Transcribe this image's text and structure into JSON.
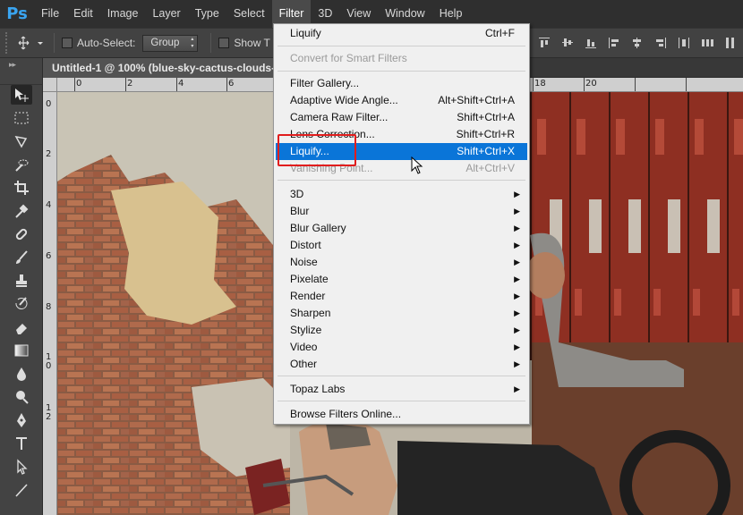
{
  "app": {
    "logo": "Ps"
  },
  "menubar": {
    "items": [
      "File",
      "Edit",
      "Image",
      "Layer",
      "Type",
      "Select",
      "Filter",
      "3D",
      "View",
      "Window",
      "Help"
    ],
    "open_index": 6
  },
  "options_bar": {
    "auto_select_label": "Auto-Select:",
    "auto_select_value": "Group",
    "show_transform_label": "Show T"
  },
  "document": {
    "tab_title": "Untitled-1 @ 100% (blue-sky-cactus-clouds-",
    "ruler_top": [
      "0",
      "2",
      "4",
      "6",
      "18",
      "20"
    ],
    "ruler_left": [
      "0",
      "2",
      "4",
      "6",
      "8",
      "10",
      "12"
    ]
  },
  "filter_menu": {
    "last_filter": {
      "label": "Liquify",
      "shortcut": "Ctrl+F"
    },
    "convert": "Convert for Smart Filters",
    "group1": [
      {
        "label": "Filter Gallery...",
        "shortcut": ""
      },
      {
        "label": "Adaptive Wide Angle...",
        "shortcut": "Alt+Shift+Ctrl+A"
      },
      {
        "label": "Camera Raw Filter...",
        "shortcut": "Shift+Ctrl+A"
      },
      {
        "label": "Lens Correction...",
        "shortcut": "Shift+Ctrl+R"
      },
      {
        "label": "Liquify...",
        "shortcut": "Shift+Ctrl+X"
      },
      {
        "label": "Vanishing Point...",
        "shortcut": "Alt+Ctrl+V"
      }
    ],
    "submenus": [
      "3D",
      "Blur",
      "Blur Gallery",
      "Distort",
      "Noise",
      "Pixelate",
      "Render",
      "Sharpen",
      "Stylize",
      "Video",
      "Other"
    ],
    "topaz": "Topaz Labs",
    "browse": "Browse Filters Online...",
    "highlight_color": "#0a75d8",
    "callout_color": "#e11d1d"
  }
}
